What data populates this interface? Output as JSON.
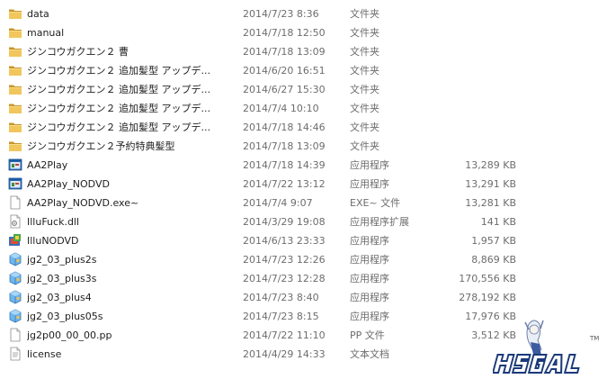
{
  "files": [
    {
      "name": "data",
      "date": "2014/7/23 8:36",
      "type": "文件夹",
      "size": "",
      "icon": "folder-icon"
    },
    {
      "name": "manual",
      "date": "2014/7/18 12:50",
      "type": "文件夹",
      "size": "",
      "icon": "folder-icon"
    },
    {
      "name": "ジンコウガクエン２ 曹",
      "date": "2014/7/18 13:09",
      "type": "文件夹",
      "size": "",
      "icon": "folder-icon"
    },
    {
      "name": "ジンコウガクエン２ 追加髪型 アップデ...",
      "date": "2014/6/20 16:51",
      "type": "文件夹",
      "size": "",
      "icon": "folder-icon"
    },
    {
      "name": "ジンコウガクエン２ 追加髪型 アップデ...",
      "date": "2014/6/27 15:30",
      "type": "文件夹",
      "size": "",
      "icon": "folder-icon"
    },
    {
      "name": "ジンコウガクエン２ 追加髪型 アップデ...",
      "date": "2014/7/4 10:10",
      "type": "文件夹",
      "size": "",
      "icon": "folder-icon"
    },
    {
      "name": "ジンコウガクエン２ 追加髪型 アップデ...",
      "date": "2014/7/18 14:46",
      "type": "文件夹",
      "size": "",
      "icon": "folder-icon"
    },
    {
      "name": "ジンコウガクエン２予約特典髪型",
      "date": "2014/7/18 13:09",
      "type": "文件夹",
      "size": "",
      "icon": "folder-icon"
    },
    {
      "name": "AA2Play",
      "date": "2014/7/18 14:39",
      "type": "应用程序",
      "size": "13,289 KB",
      "icon": "application-icon"
    },
    {
      "name": "AA2Play_NODVD",
      "date": "2014/7/22 13:12",
      "type": "应用程序",
      "size": "13,291 KB",
      "icon": "application-icon"
    },
    {
      "name": "AA2Play_NODVD.exe~",
      "date": "2014/7/4 9:07",
      "type": "EXE~ 文件",
      "size": "13,281 KB",
      "icon": "generic-file-icon"
    },
    {
      "name": "IlluFuck.dll",
      "date": "2014/3/29 19:08",
      "type": "应用程序扩展",
      "size": "141 KB",
      "icon": "dll-file-icon"
    },
    {
      "name": "IlluNODVD",
      "date": "2014/6/13 23:33",
      "type": "应用程序",
      "size": "1,957 KB",
      "icon": "installer-icon"
    },
    {
      "name": "jg2_03_plus2s",
      "date": "2014/7/23 12:26",
      "type": "应用程序",
      "size": "8,869 KB",
      "icon": "package-icon"
    },
    {
      "name": "jg2_03_plus3s",
      "date": "2014/7/23 12:28",
      "type": "应用程序",
      "size": "170,556 KB",
      "icon": "package-icon"
    },
    {
      "name": "jg2_03_plus4",
      "date": "2014/7/23 8:40",
      "type": "应用程序",
      "size": "278,192 KB",
      "icon": "package-icon"
    },
    {
      "name": "jg2_03_plus05s",
      "date": "2014/7/23 8:15",
      "type": "应用程序",
      "size": "17,976 KB",
      "icon": "package-icon"
    },
    {
      "name": "jg2p00_00_00.pp",
      "date": "2014/7/22 11:10",
      "type": "PP 文件",
      "size": "3,512 KB",
      "icon": "generic-file-icon"
    },
    {
      "name": "license",
      "date": "2014/4/29 14:33",
      "type": "文本文档",
      "size": "",
      "icon": "text-document-icon"
    }
  ],
  "watermark": {
    "tm": "TM"
  },
  "colors": {
    "folder": "#e8b84a",
    "folder_dark": "#c8952b",
    "text": "#1e1e1e",
    "meta_text": "#6d6d6d",
    "app_blue": "#2a6bb8",
    "package_blue": "#4a9ee0"
  }
}
